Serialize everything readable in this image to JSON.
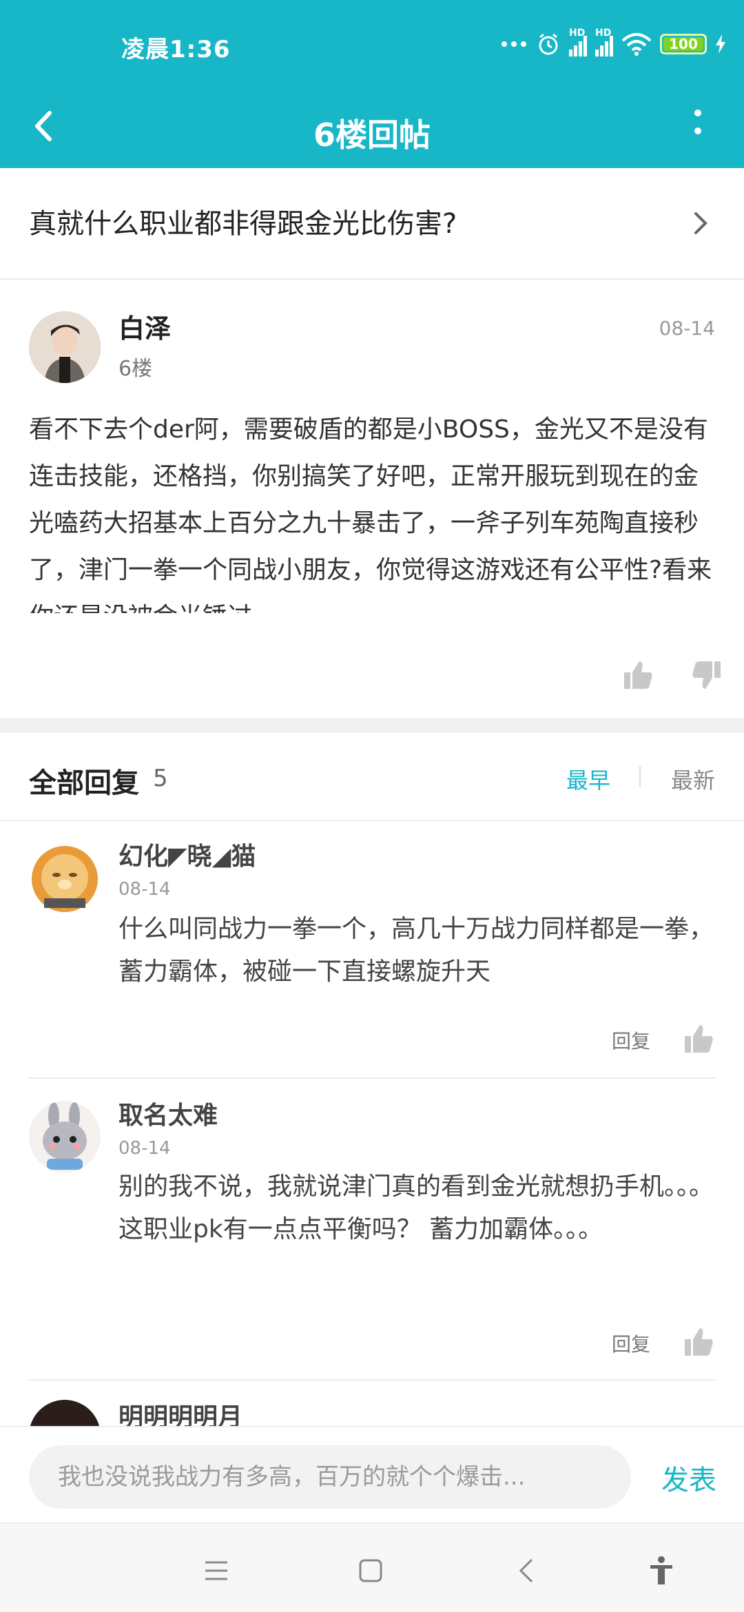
{
  "status_bar": {
    "time": "凌晨1:36",
    "battery": "100",
    "network_1": "HD",
    "network_2": "HD"
  },
  "nav": {
    "title": "6楼回帖"
  },
  "thread": {
    "title": "真就什么职业都非得跟金光比伤害?"
  },
  "post": {
    "username": "白泽",
    "floor": "6楼",
    "date": "08-14",
    "body": "看不下去个der阿，需要破盾的都是小BOSS，金光又不是没有连击技能，还格挡，你别搞笑了好吧，正常开服玩到现在的金光嗑药大招基本上百分之九十暴击了，一斧子列车苑陶直接秒了，津门一拳一个同战小朋友，你觉得这游戏还有公平性?看来你还是没被金光锤过"
  },
  "replies": {
    "title": "全部回复",
    "count": "5",
    "sort_earliest": "最早",
    "sort_latest": "最新",
    "items": [
      {
        "name": "幻化◤晓◢猫",
        "date": "08-14",
        "text": "什么叫同战力一拳一个，高几十万战力同样都是一拳，蓄力霸体，被碰一下直接螺旋升天",
        "reply_label": "回复"
      },
      {
        "name": "取名太难",
        "date": "08-14",
        "text": "别的我不说，我就说津门真的看到金光就想扔手机。。。这职业pk有一点点平衡吗？ 蓄力加霸体。。。",
        "reply_label": "回复"
      },
      {
        "name": "明明明明月"
      }
    ]
  },
  "composer": {
    "placeholder": "我也没说我战力有多高，百万的就个个爆击...",
    "publish": "发表"
  }
}
